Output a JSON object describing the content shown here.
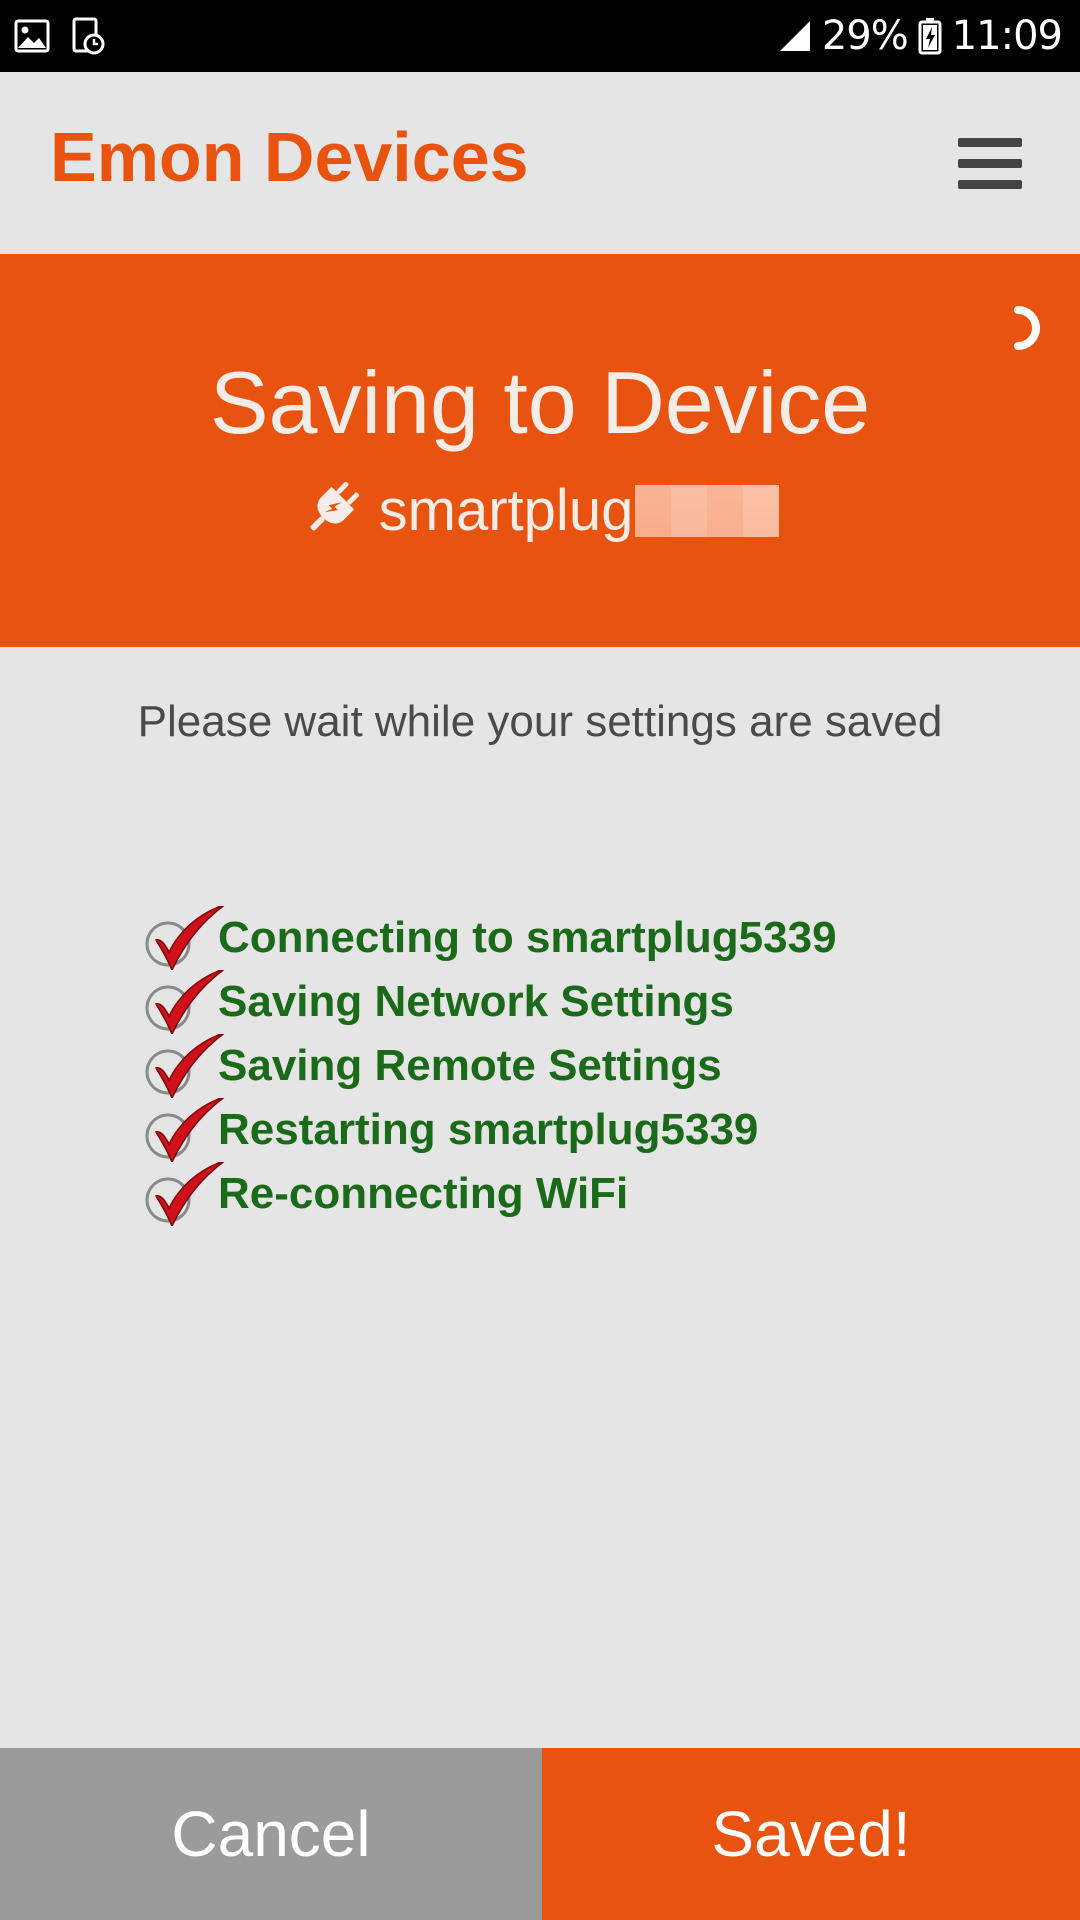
{
  "status_bar": {
    "battery": "29%",
    "time": "11:09",
    "icons": [
      "image-icon",
      "screen-timer-icon",
      "signal-icon",
      "battery-charging-icon"
    ]
  },
  "app_bar": {
    "title": "Emon Devices",
    "menu_icon": "hamburger-menu-icon"
  },
  "header": {
    "title": "Saving to Device",
    "device_name": "smartplug",
    "device_icon": "plug-icon",
    "spinner_icon": "loading-spinner-icon"
  },
  "body": {
    "message": "Please wait while your settings are saved",
    "steps": [
      {
        "label": "Connecting to smartplug5339",
        "done": true
      },
      {
        "label": "Saving Network Settings",
        "done": true
      },
      {
        "label": "Saving Remote Settings",
        "done": true
      },
      {
        "label": "Restarting smartplug5339",
        "done": true
      },
      {
        "label": "Re-connecting WiFi",
        "done": true
      }
    ]
  },
  "buttons": {
    "cancel_label": "Cancel",
    "saved_label": "Saved!"
  },
  "colors": {
    "accent": "#e8530f",
    "step_text": "#1a6a1a",
    "check": "#d0101a",
    "cancel_bg": "#9b9b9b",
    "background": "#e5e5e5"
  }
}
